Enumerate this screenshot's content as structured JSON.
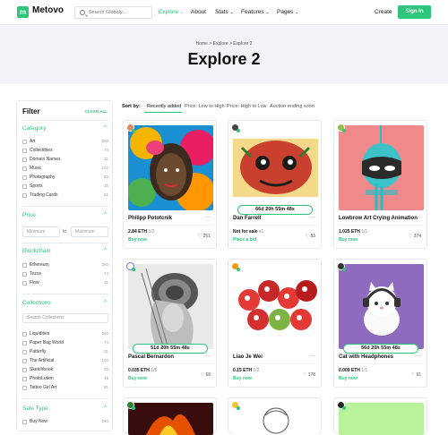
{
  "header": {
    "logo_letter": "m",
    "logo_text": "Metovo",
    "search_placeholder": "Search Globaly...",
    "nav": [
      {
        "label": "Explore",
        "chevron": "⌄",
        "active": true
      },
      {
        "label": "About"
      },
      {
        "label": "Stats",
        "chevron": "⌄"
      },
      {
        "label": "Features",
        "chevron": "⌄"
      },
      {
        "label": "Pages",
        "chevron": "⌄"
      }
    ],
    "create_label": "Create",
    "signin_label": "Sign In"
  },
  "hero": {
    "breadcrumb": [
      "Home",
      "Explore",
      "Explore 2"
    ],
    "breadcrumb_sep": ">",
    "title": "Explore 2"
  },
  "filter": {
    "title": "Filter",
    "clear_all": "CLEAR ALL",
    "category": {
      "title": "Category",
      "items": [
        {
          "label": "Art",
          "count": "250"
        },
        {
          "label": "Collectibles",
          "count": "74"
        },
        {
          "label": "Domain Names",
          "count": "31"
        },
        {
          "label": "Music",
          "count": "102"
        },
        {
          "label": "Photography",
          "count": "63"
        },
        {
          "label": "Sports",
          "count": "15"
        },
        {
          "label": "Trading Cards",
          "count": "91"
        }
      ]
    },
    "price": {
      "title": "Price",
      "min_placeholder": "Minimum",
      "to_label": "to",
      "max_placeholder": "Maximum"
    },
    "blockchain": {
      "title": "Blockchain",
      "items": [
        {
          "label": "Ethereum",
          "count": "250"
        },
        {
          "label": "Tezos",
          "count": "74"
        },
        {
          "label": "Flow",
          "count": "31"
        }
      ]
    },
    "collections": {
      "title": "Collections",
      "search_placeholder": "Search Collections",
      "items": [
        {
          "label": "Liquidities",
          "count": "250"
        },
        {
          "label": "Paper Bag World",
          "count": "74"
        },
        {
          "label": "Patterfly",
          "count": "31"
        },
        {
          "label": "The Artificial",
          "count": "102"
        },
        {
          "label": "Sketchbook",
          "count": "63"
        },
        {
          "label": "PhotoLution",
          "count": "15"
        },
        {
          "label": "Tattoo Girl Art",
          "count": "91"
        }
      ]
    },
    "sale_type": {
      "title": "Sale Type",
      "items": [
        {
          "label": "Buy Now",
          "count": "250"
        }
      ]
    },
    "chevron": "^"
  },
  "sort": {
    "label": "Sort by:",
    "options": [
      "Recently added",
      "Price: Low to High",
      "Price: High to Low",
      "Auction ending soon"
    ]
  },
  "cards": [
    {
      "name": "Philipp Pototcnik",
      "price": "2.84 ETH",
      "edition": "1/2",
      "status": "Buy now",
      "likes": "251",
      "timer": ""
    },
    {
      "name": "Dan Farrell",
      "price": "Not for sale",
      "edition": "x1",
      "status": "Place a bid",
      "likes": "83",
      "timer": "66d  20h  55m  48s"
    },
    {
      "name": "Lowbrow Art Crying Animation",
      "price": "1.025 ETH",
      "edition": "1/1",
      "status": "Buy now",
      "likes": "374",
      "timer": ""
    },
    {
      "name": "Pascal Bernardon",
      "price": "0.035 ETH",
      "edition": "1/5",
      "status": "Buy now",
      "likes": "68",
      "timer": "51d  20h  55m  48s"
    },
    {
      "name": "Liao Je Wei",
      "price": "0.15 ETH",
      "edition": "1/2",
      "status": "Buy now",
      "likes": "178",
      "timer": ""
    },
    {
      "name": "Cat with Headphones",
      "price": "0.009 ETH",
      "edition": "1/1",
      "status": "Buy now",
      "likes": "91",
      "timer": "56d  20h  55m  48s"
    }
  ],
  "icons": {
    "heart": "♡",
    "more": "···"
  },
  "colors": {
    "accent": "#2fc67b",
    "hero_bg": "#f2f4f7"
  }
}
